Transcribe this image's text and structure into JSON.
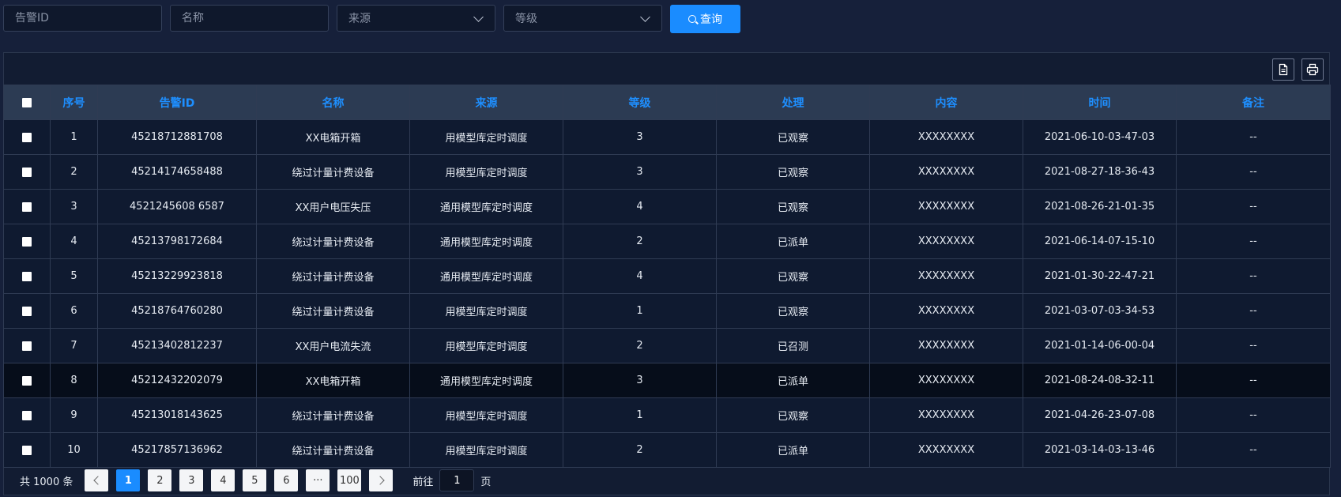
{
  "filters": {
    "alarm_id_placeholder": "告警ID",
    "name_placeholder": "名称",
    "source_placeholder": "来源",
    "level_placeholder": "等级",
    "query_label": "查询"
  },
  "toolbar": {
    "export_icon": "document-icon",
    "print_icon": "printer-icon"
  },
  "table": {
    "headers": [
      "序号",
      "告警ID",
      "名称",
      "来源",
      "等级",
      "处理",
      "内容",
      "时间",
      "备注"
    ],
    "rows": [
      {
        "no": "1",
        "id": "45218712881708",
        "name": "XX电箱开箱",
        "source": "用模型库定时调度",
        "level": "3",
        "status": "已观察",
        "content": "XXXXXXXX",
        "time": "2021-06-10-03-47-03",
        "note": "--"
      },
      {
        "no": "2",
        "id": "45214174658488",
        "name": "绕过计量计费设备",
        "source": "用模型库定时调度",
        "level": "3",
        "status": "已观察",
        "content": "XXXXXXXX",
        "time": "2021-08-27-18-36-43",
        "note": "--"
      },
      {
        "no": "3",
        "id": "4521245608 6587",
        "name": "XX用户电压失压",
        "source": "通用模型库定时调度",
        "level": "4",
        "status": "已观察",
        "content": "XXXXXXXX",
        "time": "2021-08-26-21-01-35",
        "note": "--"
      },
      {
        "no": "4",
        "id": "45213798172684",
        "name": "绕过计量计费设备",
        "source": "通用模型库定时调度",
        "level": "2",
        "status": "已派单",
        "content": "XXXXXXXX",
        "time": "2021-06-14-07-15-10",
        "note": "--"
      },
      {
        "no": "5",
        "id": "45213229923818",
        "name": "绕过计量计费设备",
        "source": "通用模型库定时调度",
        "level": "4",
        "status": "已观察",
        "content": "XXXXXXXX",
        "time": "2021-01-30-22-47-21",
        "note": "--"
      },
      {
        "no": "6",
        "id": "45218764760280",
        "name": "绕过计量计费设备",
        "source": "用模型库定时调度",
        "level": "1",
        "status": "已观察",
        "content": "XXXXXXXX",
        "time": "2021-03-07-03-34-53",
        "note": "--"
      },
      {
        "no": "7",
        "id": "45213402812237",
        "name": "XX用户电流失流",
        "source": "用模型库定时调度",
        "level": "2",
        "status": "已召测",
        "content": "XXXXXXXX",
        "time": "2021-01-14-06-00-04",
        "note": "--"
      },
      {
        "no": "8",
        "id": "45212432202079",
        "name": "XX电箱开箱",
        "source": "通用模型库定时调度",
        "level": "3",
        "status": "已派单",
        "content": "XXXXXXXX",
        "time": "2021-08-24-08-32-11",
        "note": "--"
      },
      {
        "no": "9",
        "id": "45213018143625",
        "name": "绕过计量计费设备",
        "source": "用模型库定时调度",
        "level": "1",
        "status": "已观察",
        "content": "XXXXXXXX",
        "time": "2021-04-26-23-07-08",
        "note": "--"
      },
      {
        "no": "10",
        "id": "45217857136962",
        "name": "绕过计量计费设备",
        "source": "用模型库定时调度",
        "level": "2",
        "status": "已派单",
        "content": "XXXXXXXX",
        "time": "2021-03-14-03-13-46",
        "note": "--"
      }
    ]
  },
  "pagination": {
    "total_text": "共 1000 条",
    "pages": [
      "1",
      "2",
      "3",
      "4",
      "5",
      "6",
      "···",
      "100"
    ],
    "active_page": "1",
    "goto_prefix": "前往",
    "goto_value": "1",
    "goto_suffix": "页"
  }
}
